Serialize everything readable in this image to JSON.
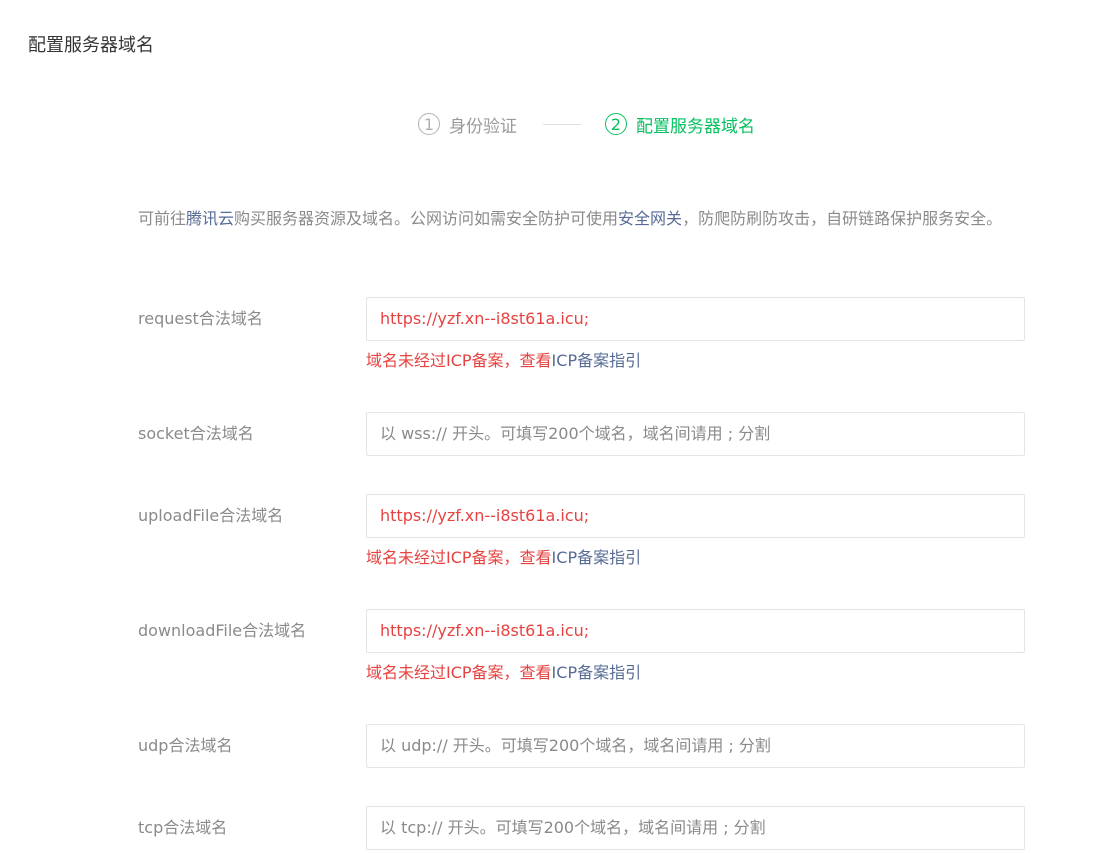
{
  "page": {
    "title": "配置服务器域名"
  },
  "steps": [
    {
      "num": "1",
      "label": "身份验证",
      "active": false
    },
    {
      "num": "2",
      "label": "配置服务器域名",
      "active": true
    }
  ],
  "intro": {
    "prefix": "可前往",
    "link1": "腾讯云",
    "middle": "购买服务器资源及域名。公网访问如需安全防护可使用",
    "link2": "安全网关",
    "suffix": "，防爬防刷防攻击，自研链路保护服务安全。"
  },
  "domains": {
    "request": {
      "label": "request合法域名",
      "value": "https://yzf.xn--i8st61a.icu;",
      "warning": "域名未经过ICP备案，查看",
      "warning_link": "ICP备案指引"
    },
    "socket": {
      "label": "socket合法域名",
      "placeholder": "以 wss:// 开头。可填写200个域名，域名间请用 ; 分割"
    },
    "uploadFile": {
      "label": "uploadFile合法域名",
      "value": "https://yzf.xn--i8st61a.icu;",
      "warning": "域名未经过ICP备案，查看",
      "warning_link": "ICP备案指引"
    },
    "downloadFile": {
      "label": "downloadFile合法域名",
      "value": "https://yzf.xn--i8st61a.icu;",
      "warning": "域名未经过ICP备案，查看",
      "warning_link": "ICP备案指引"
    },
    "udp": {
      "label": "udp合法域名",
      "placeholder": "以 udp:// 开头。可填写200个域名，域名间请用 ; 分割"
    },
    "tcp": {
      "label": "tcp合法域名",
      "placeholder": "以 tcp:// 开头。可填写200个域名，域名间请用 ; 分割"
    }
  },
  "colors": {
    "accent_green": "#07c160",
    "error_red": "#e64340",
    "link_blue": "#576b95"
  }
}
